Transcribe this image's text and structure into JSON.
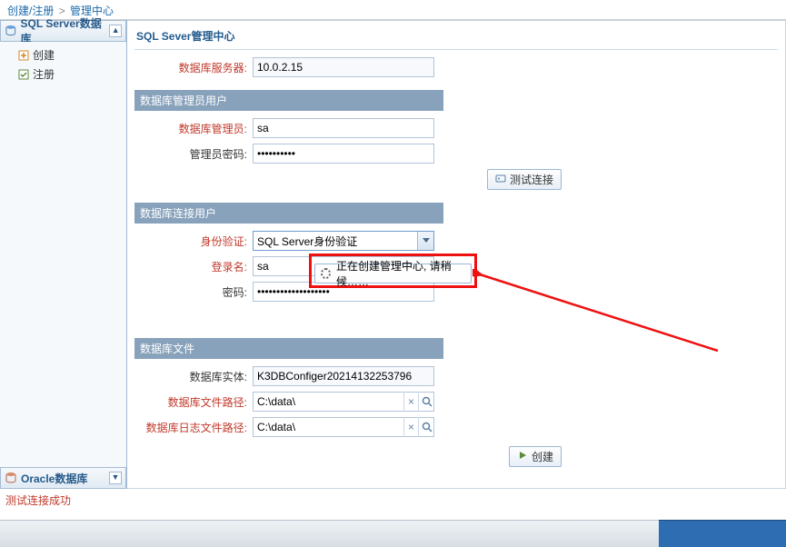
{
  "breadcrumb": {
    "create_register": "创建/注册",
    "mgmt_center": "管理中心"
  },
  "sidebar": {
    "sql_panel_title": "SQL Server数据库",
    "oracle_panel_title": "Oracle数据库",
    "tree": {
      "create": "创建",
      "register": "注册"
    }
  },
  "content": {
    "title": "SQL Sever管理中心",
    "server_label": "数据库服务器:",
    "server_value": "10.0.2.15",
    "section_admin": "数据库管理员用户",
    "admin_label": "数据库管理员:",
    "admin_value": "sa",
    "admin_pw_label": "管理员密码:",
    "admin_pw_value": "••••••••••",
    "test_conn_label": "测试连接",
    "section_conn": "数据库连接用户",
    "auth_label": "身份验证:",
    "auth_value": "SQL Server身份验证",
    "login_label": "登录名:",
    "login_value": "sa",
    "password_label": "密码:",
    "password_value": "•••••••••••••••••••",
    "section_file": "数据库文件",
    "entity_label": "数据库实体:",
    "entity_value": "K3DBConfiger20214132253796",
    "file_path_label": "数据库文件路径:",
    "file_path_value": "C:\\data\\",
    "log_path_label": "数据库日志文件路径:",
    "log_path_value": "C:\\data\\",
    "create_btn": "创建"
  },
  "modal": {
    "text": "正在创建管理中心, 请稍候……"
  },
  "status": {
    "text": "测试连接成功"
  }
}
